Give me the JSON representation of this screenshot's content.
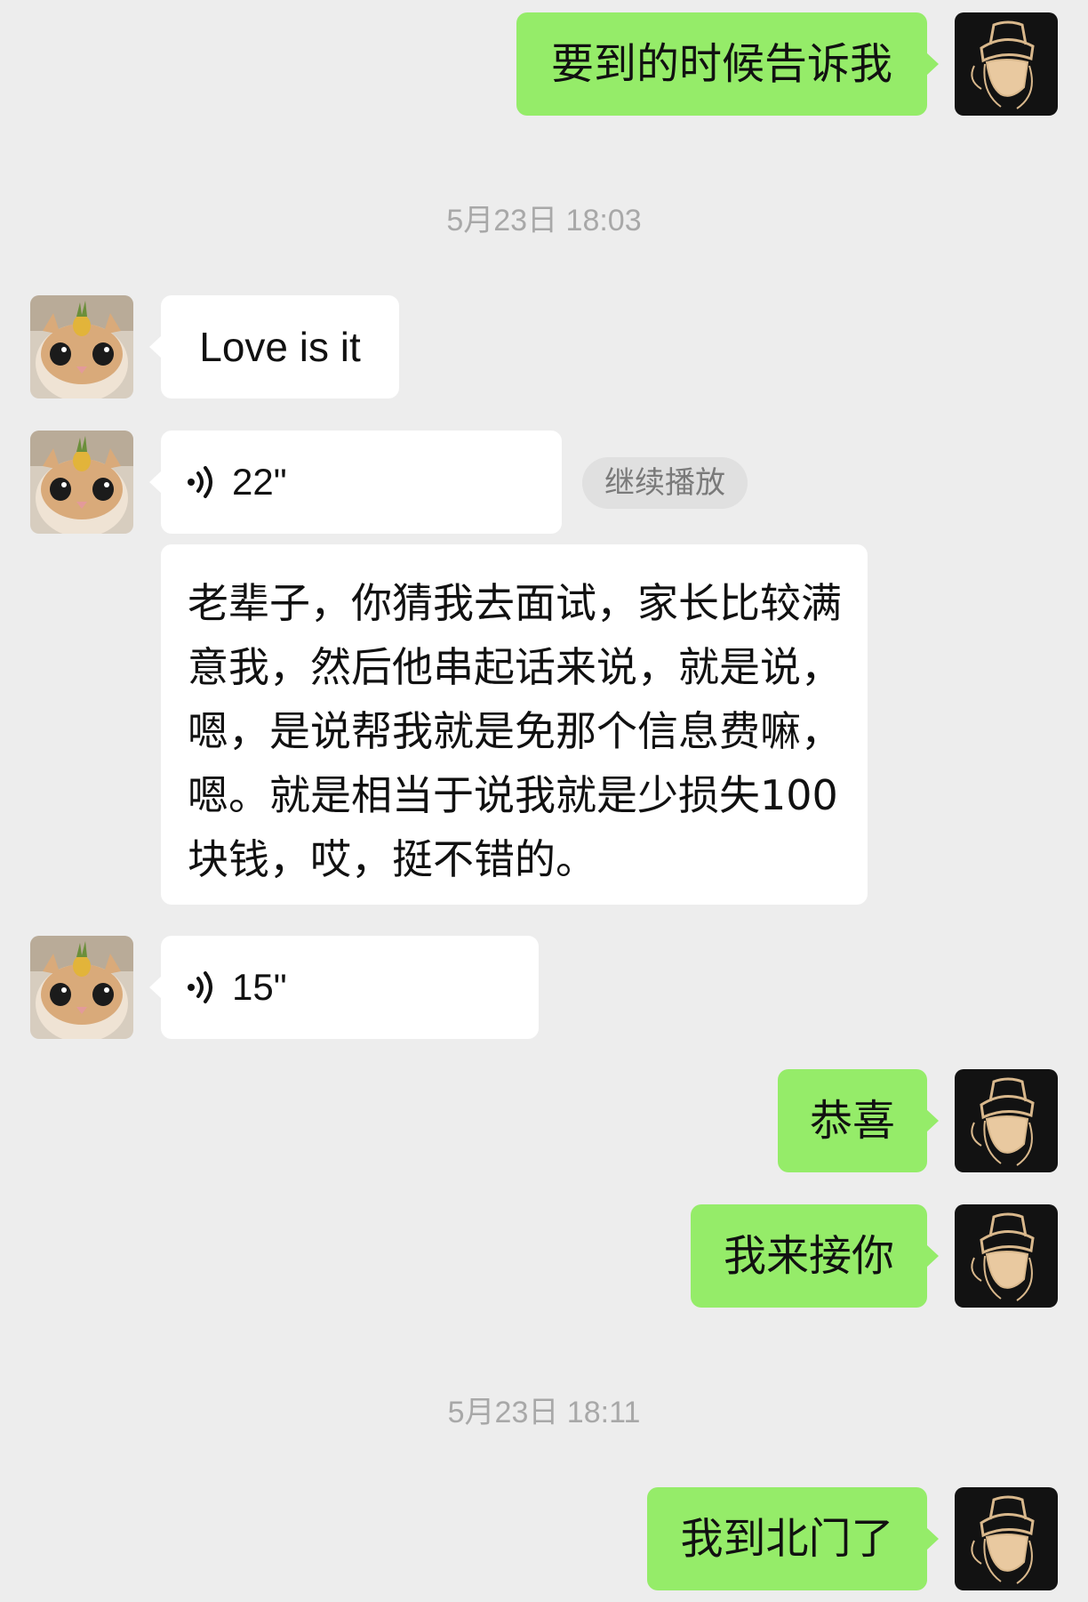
{
  "messages": {
    "m1": {
      "text": "要到的时候告诉我"
    },
    "time1": "5月23日 18:03",
    "m2": {
      "text": "Love is it"
    },
    "m3": {
      "duration": "22\"",
      "action": "继续播放"
    },
    "m4": {
      "text": "老辈子，你猜我去面试，家长比较满意我，然后他串起话来说，就是说，嗯，是说帮我就是免那个信息费嘛，嗯。就是相当于说我就是少损失100块钱，哎，挺不错的。"
    },
    "m5": {
      "duration": "15\""
    },
    "m6": {
      "text": "恭喜"
    },
    "m7": {
      "text": "我来接你"
    },
    "time2": "5月23日 18:11",
    "m8": {
      "text": "我到北门了"
    }
  },
  "icons": {
    "my_avatar": "hat-silhouette-avatar",
    "their_avatar": "cat-pineapple-avatar",
    "voice": "voice-wave-icon"
  },
  "colors": {
    "background": "#ededed",
    "my_bubble": "#95ec69",
    "their_bubble": "#ffffff",
    "timestamp": "#a8a8a8"
  }
}
